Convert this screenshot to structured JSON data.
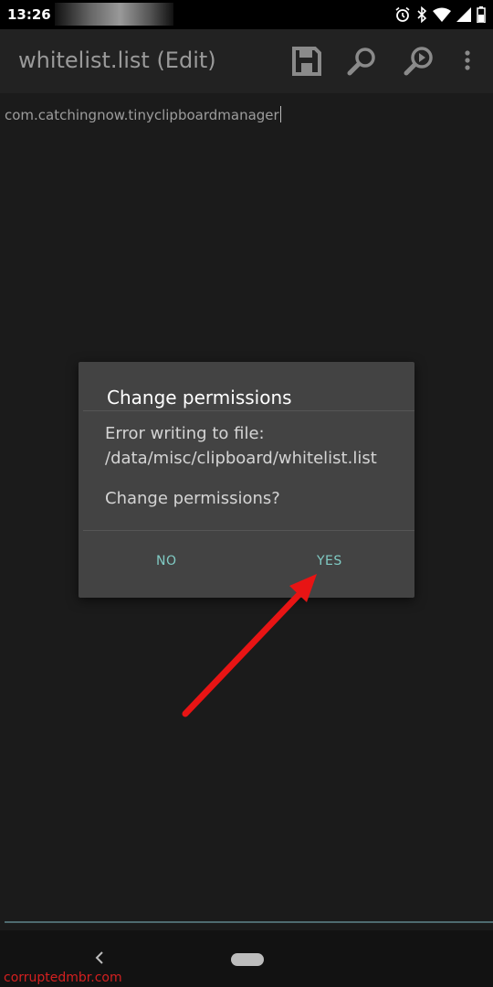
{
  "status_bar": {
    "time": "13:26",
    "icons": [
      "alarm-icon",
      "bluetooth-icon",
      "wifi-icon",
      "signal-icon",
      "battery-icon"
    ]
  },
  "app_bar": {
    "title": "whitelist.list (Edit)",
    "actions": [
      "save-icon",
      "search-icon",
      "find-next-icon",
      "overflow-menu-icon"
    ]
  },
  "editor": {
    "content": "com.catchingnow.tinyclipboardmanager"
  },
  "dialog": {
    "title": "Change permissions",
    "message": "Error writing to file: /data/misc/clipboard/whitelist.list",
    "question": "Change permissions?",
    "buttons": {
      "no": "NO",
      "yes": "YES"
    },
    "accent_color": "#80cbc4"
  },
  "annotation": {
    "arrow_color": "#e81414"
  },
  "watermark": "corruptedmbr.com"
}
